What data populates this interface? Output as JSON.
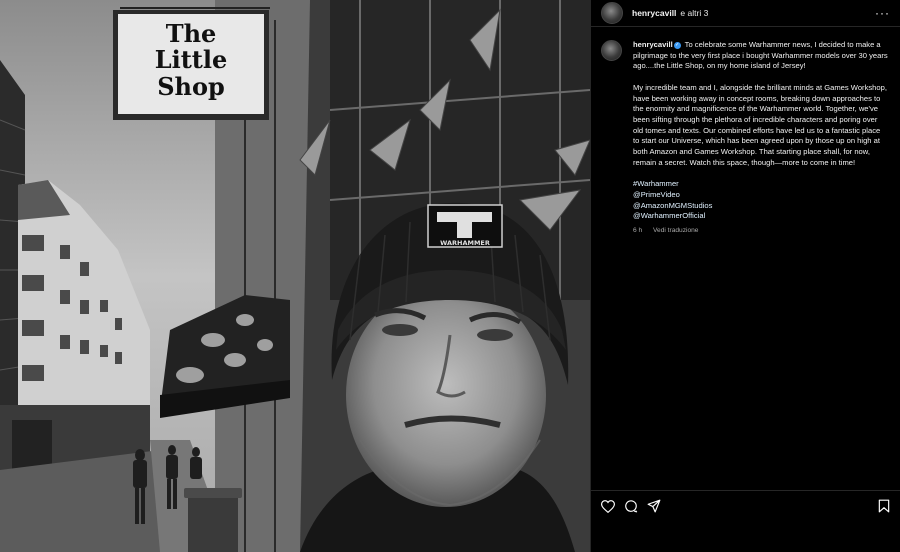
{
  "sign": {
    "line1": "The",
    "line2": "Little",
    "line3": "Shop"
  },
  "hat_logo": "WARHAMMER",
  "header": {
    "username": "henrycavill",
    "others": "e altri 3"
  },
  "caption": {
    "username": "henrycavill",
    "p1": "To celebrate some Warhammer news, I decided to make a pilgrimage to the very first place i bought Warhammer models over 30 years ago....the Little Shop, on my home island of Jersey!",
    "p2": "My incredible team and I, alongside the brilliant minds at Games Workshop, have been working away in concept rooms, breaking down approaches to the enormity and magnificence of the Warhammer world. Together, we've been sifting through the plethora of incredible characters and poring over old tomes and texts. Our combined efforts have led us to a fantastic place to start our Universe, which has been agreed upon by those up on high at both Amazon and Games Workshop. That starting place shall, for now, remain a secret. Watch this space, though—more to come in time!",
    "tags": [
      "#Warhammer",
      "@PrimeVideo",
      "@AmazonMGMStudios",
      "@WarhammerOfficial"
    ]
  },
  "meta": {
    "time": "6 h",
    "translate": "Vedi traduzione"
  },
  "icons": {
    "more": "more-options-icon",
    "verified": "verified-badge-icon",
    "like": "heart-icon",
    "comment": "comment-icon",
    "share": "share-icon",
    "save": "bookmark-icon"
  },
  "colors": {
    "background": "#000000",
    "verified": "#3897f0",
    "text": "#f5f5f5",
    "muted": "#a8a8a8"
  }
}
